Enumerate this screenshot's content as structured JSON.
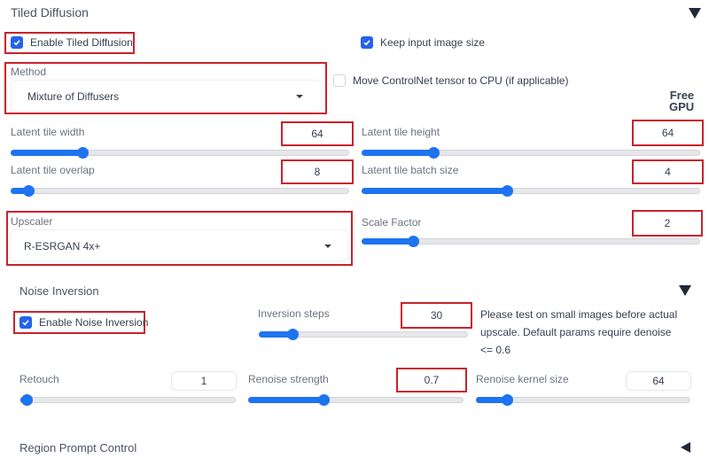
{
  "tiled_diffusion": {
    "title": "Tiled Diffusion",
    "collapse_icon": "triangle-down-icon",
    "enable": {
      "label": "Enable Tiled Diffusion",
      "checked": true
    },
    "keep_size": {
      "label": "Keep input image size",
      "checked": true
    },
    "move_controlnet": {
      "label": "Move ControlNet tensor to CPU (if applicable)",
      "checked": false
    },
    "free_gpu_label": "Free\nGPU",
    "method": {
      "label": "Method",
      "value": "Mixture of Diffusers"
    },
    "latent_tile_width": {
      "label": "Latent tile width",
      "value": "64",
      "fraction": 0.21
    },
    "latent_tile_height": {
      "label": "Latent tile height",
      "value": "64",
      "fraction": 0.21
    },
    "latent_tile_overlap": {
      "label": "Latent tile overlap",
      "value": "8",
      "fraction": 0.05
    },
    "latent_tile_batch_size": {
      "label": "Latent tile batch size",
      "value": "4",
      "fraction": 0.43
    },
    "upscaler": {
      "label": "Upscaler",
      "value": "R-ESRGAN 4x+"
    },
    "scale_factor": {
      "label": "Scale Factor",
      "value": "2",
      "fraction": 0.15
    }
  },
  "noise_inversion": {
    "title": "Noise Inversion",
    "collapse_icon": "triangle-down-icon",
    "enable": {
      "label": "Enable Noise Inversion",
      "checked": true
    },
    "inversion_steps": {
      "label": "Inversion steps",
      "value": "30",
      "fraction": 0.16
    },
    "note": "Please test on small images before actual upscale. Default params require denoise <= 0.6",
    "retouch": {
      "label": "Retouch",
      "value": "1",
      "fraction": 0.0
    },
    "renoise_strength": {
      "label": "Renoise strength",
      "value": "0.7",
      "fraction": 0.35
    },
    "renoise_kernel_size": {
      "label": "Renoise kernel size",
      "value": "64",
      "fraction": 0.14
    }
  },
  "region_prompt": {
    "title": "Region Prompt Control",
    "expand_icon": "triangle-left-icon"
  },
  "colors": {
    "accent": "#1e73f0",
    "checkbox": "#2563eb",
    "highlight_box": "#c8232c"
  }
}
